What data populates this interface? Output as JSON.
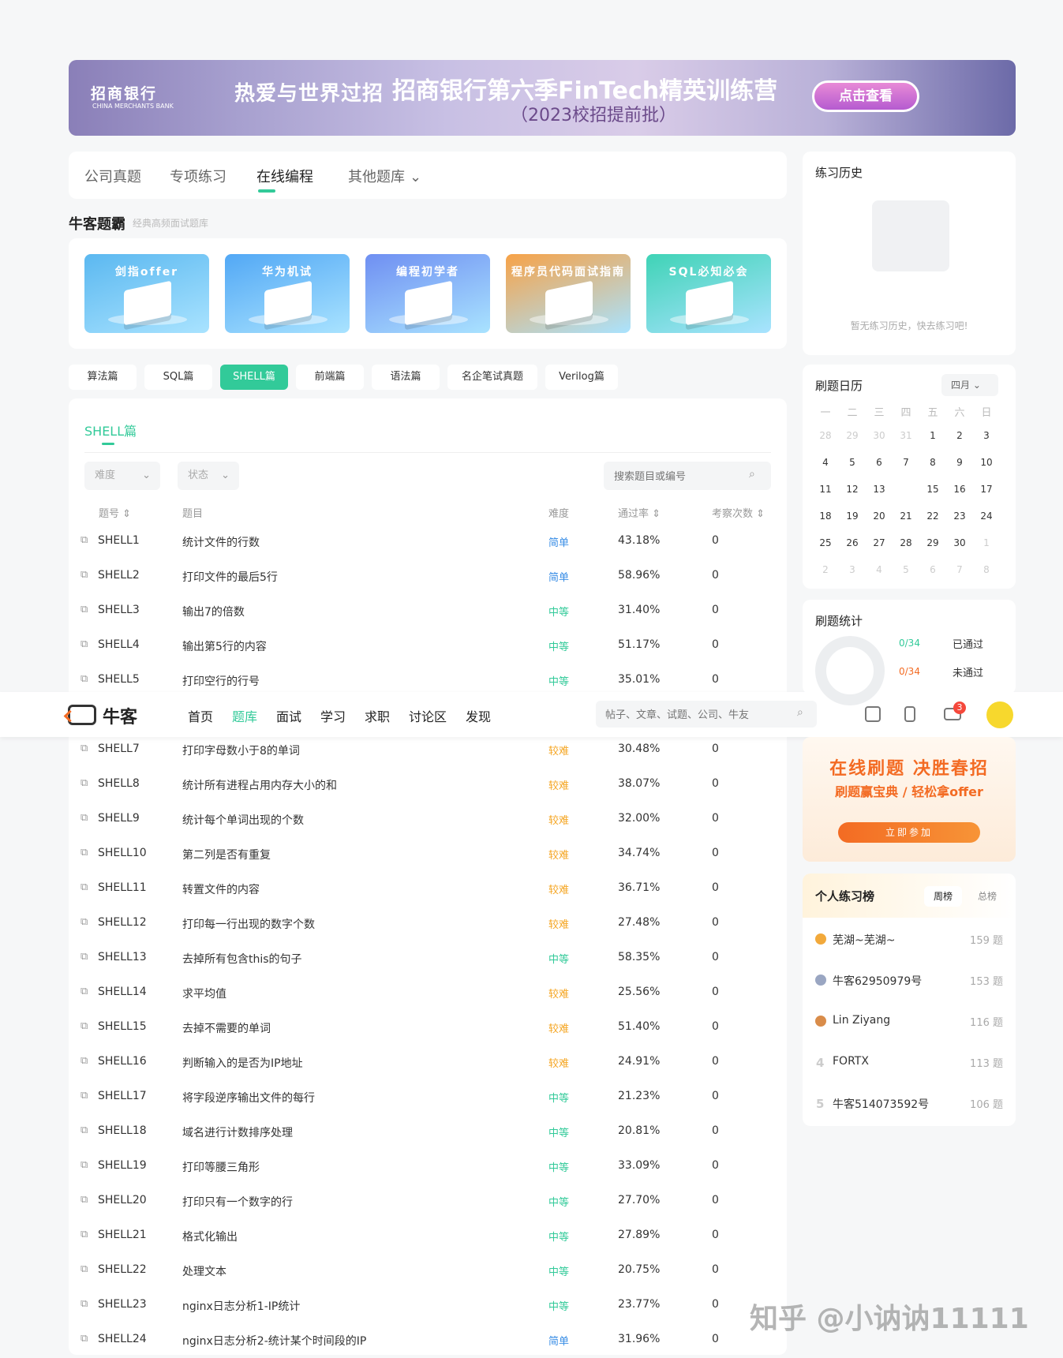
{
  "banner": {
    "logo": "招商银行",
    "logo_en": "CHINA MERCHANTS BANK",
    "slogan": "热爱与世界过招",
    "headline": "招商银行第六季FinTech精英训练营",
    "sub": "（2023校招提前批）",
    "cta": "点击查看"
  },
  "tabs": [
    {
      "label": "公司真题"
    },
    {
      "label": "专项练习"
    },
    {
      "label": "在线编程",
      "active": true
    },
    {
      "label": "其他题库"
    }
  ],
  "bawang": {
    "title": "牛客题霸",
    "subtitle": "经典高频面试题库"
  },
  "cards": [
    {
      "label": "剑指offer",
      "color": "#5bb8f0"
    },
    {
      "label": "华为机试",
      "color": "#52a8f5"
    },
    {
      "label": "编程初学者",
      "color": "#6f8ff2"
    },
    {
      "label": "程序员代码面试指南",
      "color": "#f7a247"
    },
    {
      "label": "SQL必知必会",
      "color": "#3fd3b6"
    }
  ],
  "pills": [
    "算法篇",
    "SQL篇",
    "SHELL篇",
    "前端篇",
    "语法篇",
    "名企笔试真题",
    "Verilog篇"
  ],
  "active_pill": "SHELL篇",
  "list": {
    "title": "SHELL篇",
    "filter_difficulty": "难度",
    "filter_status": "状态",
    "search_placeholder": "搜索题目或编号",
    "headers": {
      "id": "题号",
      "title": "题目",
      "difficulty": "难度",
      "rate": "通过率",
      "count": "考察次数"
    },
    "rows": [
      {
        "id": "SHELL1",
        "title": "统计文件的行数",
        "difficulty": "简单",
        "level": "e",
        "rate": "43.18%",
        "count": "0"
      },
      {
        "id": "SHELL2",
        "title": "打印文件的最后5行",
        "difficulty": "简单",
        "level": "e",
        "rate": "58.96%",
        "count": "0"
      },
      {
        "id": "SHELL3",
        "title": "输出7的倍数",
        "difficulty": "中等",
        "level": "m",
        "rate": "31.40%",
        "count": "0"
      },
      {
        "id": "SHELL4",
        "title": "输出第5行的内容",
        "difficulty": "中等",
        "level": "m",
        "rate": "51.17%",
        "count": "0"
      },
      {
        "id": "SHELL5",
        "title": "打印空行的行号",
        "difficulty": "中等",
        "level": "m",
        "rate": "35.01%",
        "count": "0"
      },
      {
        "id": "SHELL7",
        "title": "打印字母数小于8的单词",
        "difficulty": "较难",
        "level": "h",
        "rate": "30.48%",
        "count": "0"
      },
      {
        "id": "SHELL8",
        "title": "统计所有进程占用内存大小的和",
        "difficulty": "较难",
        "level": "h",
        "rate": "38.07%",
        "count": "0"
      },
      {
        "id": "SHELL9",
        "title": "统计每个单词出现的个数",
        "difficulty": "较难",
        "level": "h",
        "rate": "32.00%",
        "count": "0"
      },
      {
        "id": "SHELL10",
        "title": "第二列是否有重复",
        "difficulty": "较难",
        "level": "h",
        "rate": "34.74%",
        "count": "0"
      },
      {
        "id": "SHELL11",
        "title": "转置文件的内容",
        "difficulty": "较难",
        "level": "h",
        "rate": "36.71%",
        "count": "0"
      },
      {
        "id": "SHELL12",
        "title": "打印每一行出现的数字个数",
        "difficulty": "较难",
        "level": "h",
        "rate": "27.48%",
        "count": "0"
      },
      {
        "id": "SHELL13",
        "title": "去掉所有包含this的句子",
        "difficulty": "中等",
        "level": "m",
        "rate": "58.35%",
        "count": "0"
      },
      {
        "id": "SHELL14",
        "title": "求平均值",
        "difficulty": "较难",
        "level": "h",
        "rate": "25.56%",
        "count": "0"
      },
      {
        "id": "SHELL15",
        "title": "去掉不需要的单词",
        "difficulty": "较难",
        "level": "h",
        "rate": "51.40%",
        "count": "0"
      },
      {
        "id": "SHELL16",
        "title": "判断输入的是否为IP地址",
        "difficulty": "较难",
        "level": "h",
        "rate": "24.91%",
        "count": "0"
      },
      {
        "id": "SHELL17",
        "title": "将字段逆序输出文件的每行",
        "difficulty": "中等",
        "level": "m",
        "rate": "21.23%",
        "count": "0"
      },
      {
        "id": "SHELL18",
        "title": "域名进行计数排序处理",
        "difficulty": "中等",
        "level": "m",
        "rate": "20.81%",
        "count": "0"
      },
      {
        "id": "SHELL19",
        "title": "打印等腰三角形",
        "difficulty": "中等",
        "level": "m",
        "rate": "33.09%",
        "count": "0"
      },
      {
        "id": "SHELL20",
        "title": "打印只有一个数字的行",
        "difficulty": "中等",
        "level": "m",
        "rate": "27.70%",
        "count": "0"
      },
      {
        "id": "SHELL21",
        "title": "格式化输出",
        "difficulty": "中等",
        "level": "m",
        "rate": "27.89%",
        "count": "0"
      },
      {
        "id": "SHELL22",
        "title": "处理文本",
        "difficulty": "中等",
        "level": "m",
        "rate": "20.75%",
        "count": "0"
      },
      {
        "id": "SHELL23",
        "title": "nginx日志分析1-IP统计",
        "difficulty": "中等",
        "level": "m",
        "rate": "23.77%",
        "count": "0"
      },
      {
        "id": "SHELL24",
        "title": "nginx日志分析2-统计某个时间段的IP",
        "difficulty": "简单",
        "level": "e",
        "rate": "31.96%",
        "count": "0"
      }
    ]
  },
  "nav": {
    "logo": "牛客",
    "items": [
      "首页",
      "题库",
      "面试",
      "学习",
      "求职",
      "讨论区",
      "发现"
    ],
    "active": "题库",
    "search_placeholder": "帖子、文章、试题、公司、牛友",
    "message_badge": "3"
  },
  "history": {
    "title": "练习历史",
    "empty": "暂无练习历史，快去练习吧!"
  },
  "calendar": {
    "title": "刷题日历",
    "month": "四月",
    "weekdays": [
      "一",
      "二",
      "三",
      "四",
      "五",
      "六",
      "日"
    ],
    "days": [
      [
        "28",
        "dim"
      ],
      [
        "29",
        "dim"
      ],
      [
        "30",
        "dim"
      ],
      [
        "31",
        "dim"
      ],
      [
        "1",
        ""
      ],
      [
        "2",
        ""
      ],
      [
        "3",
        ""
      ],
      [
        "4",
        ""
      ],
      [
        "5",
        ""
      ],
      [
        "6",
        ""
      ],
      [
        "7",
        ""
      ],
      [
        "8",
        ""
      ],
      [
        "9",
        ""
      ],
      [
        "10",
        ""
      ],
      [
        "11",
        ""
      ],
      [
        "12",
        ""
      ],
      [
        "13",
        ""
      ],
      [
        "14",
        "today"
      ],
      [
        "15",
        ""
      ],
      [
        "16",
        ""
      ],
      [
        "17",
        ""
      ],
      [
        "18",
        ""
      ],
      [
        "19",
        ""
      ],
      [
        "20",
        ""
      ],
      [
        "21",
        ""
      ],
      [
        "22",
        ""
      ],
      [
        "23",
        ""
      ],
      [
        "24",
        ""
      ],
      [
        "25",
        ""
      ],
      [
        "26",
        ""
      ],
      [
        "27",
        ""
      ],
      [
        "28",
        ""
      ],
      [
        "29",
        ""
      ],
      [
        "30",
        ""
      ],
      [
        "1",
        "dim"
      ],
      [
        "2",
        "dim"
      ],
      [
        "3",
        "dim"
      ],
      [
        "4",
        "dim"
      ],
      [
        "5",
        "dim"
      ],
      [
        "6",
        "dim"
      ],
      [
        "7",
        "dim"
      ],
      [
        "8",
        "dim"
      ]
    ]
  },
  "stats": {
    "title": "刷题统计",
    "passed_count": "0/34",
    "passed_label": "已通过",
    "failed_count": "0/34",
    "failed_label": "未通过"
  },
  "promo": {
    "headline": "在线刷题 决胜春招",
    "sub": "刷题赢宝典 / 轻松拿offer",
    "button": "立即参加"
  },
  "rank": {
    "title": "个人练习榜",
    "tab_week": "周榜",
    "tab_all": "总榜",
    "items": [
      {
        "rank": "1",
        "name": "芜湖~芜湖~",
        "score": "159 题",
        "medal": "#f2a93b"
      },
      {
        "rank": "2",
        "name": "牛客62950979号",
        "score": "153 题",
        "medal": "#9aa6c2"
      },
      {
        "rank": "3",
        "name": "Lin Ziyang",
        "score": "116 题",
        "medal": "#d98c4a"
      },
      {
        "rank": "4",
        "name": "FORTX",
        "score": "113 题",
        "medal": ""
      },
      {
        "rank": "5",
        "name": "牛客514073592号",
        "score": "106 题",
        "medal": ""
      }
    ]
  },
  "watermark": "知乎 @小讷讷11111"
}
